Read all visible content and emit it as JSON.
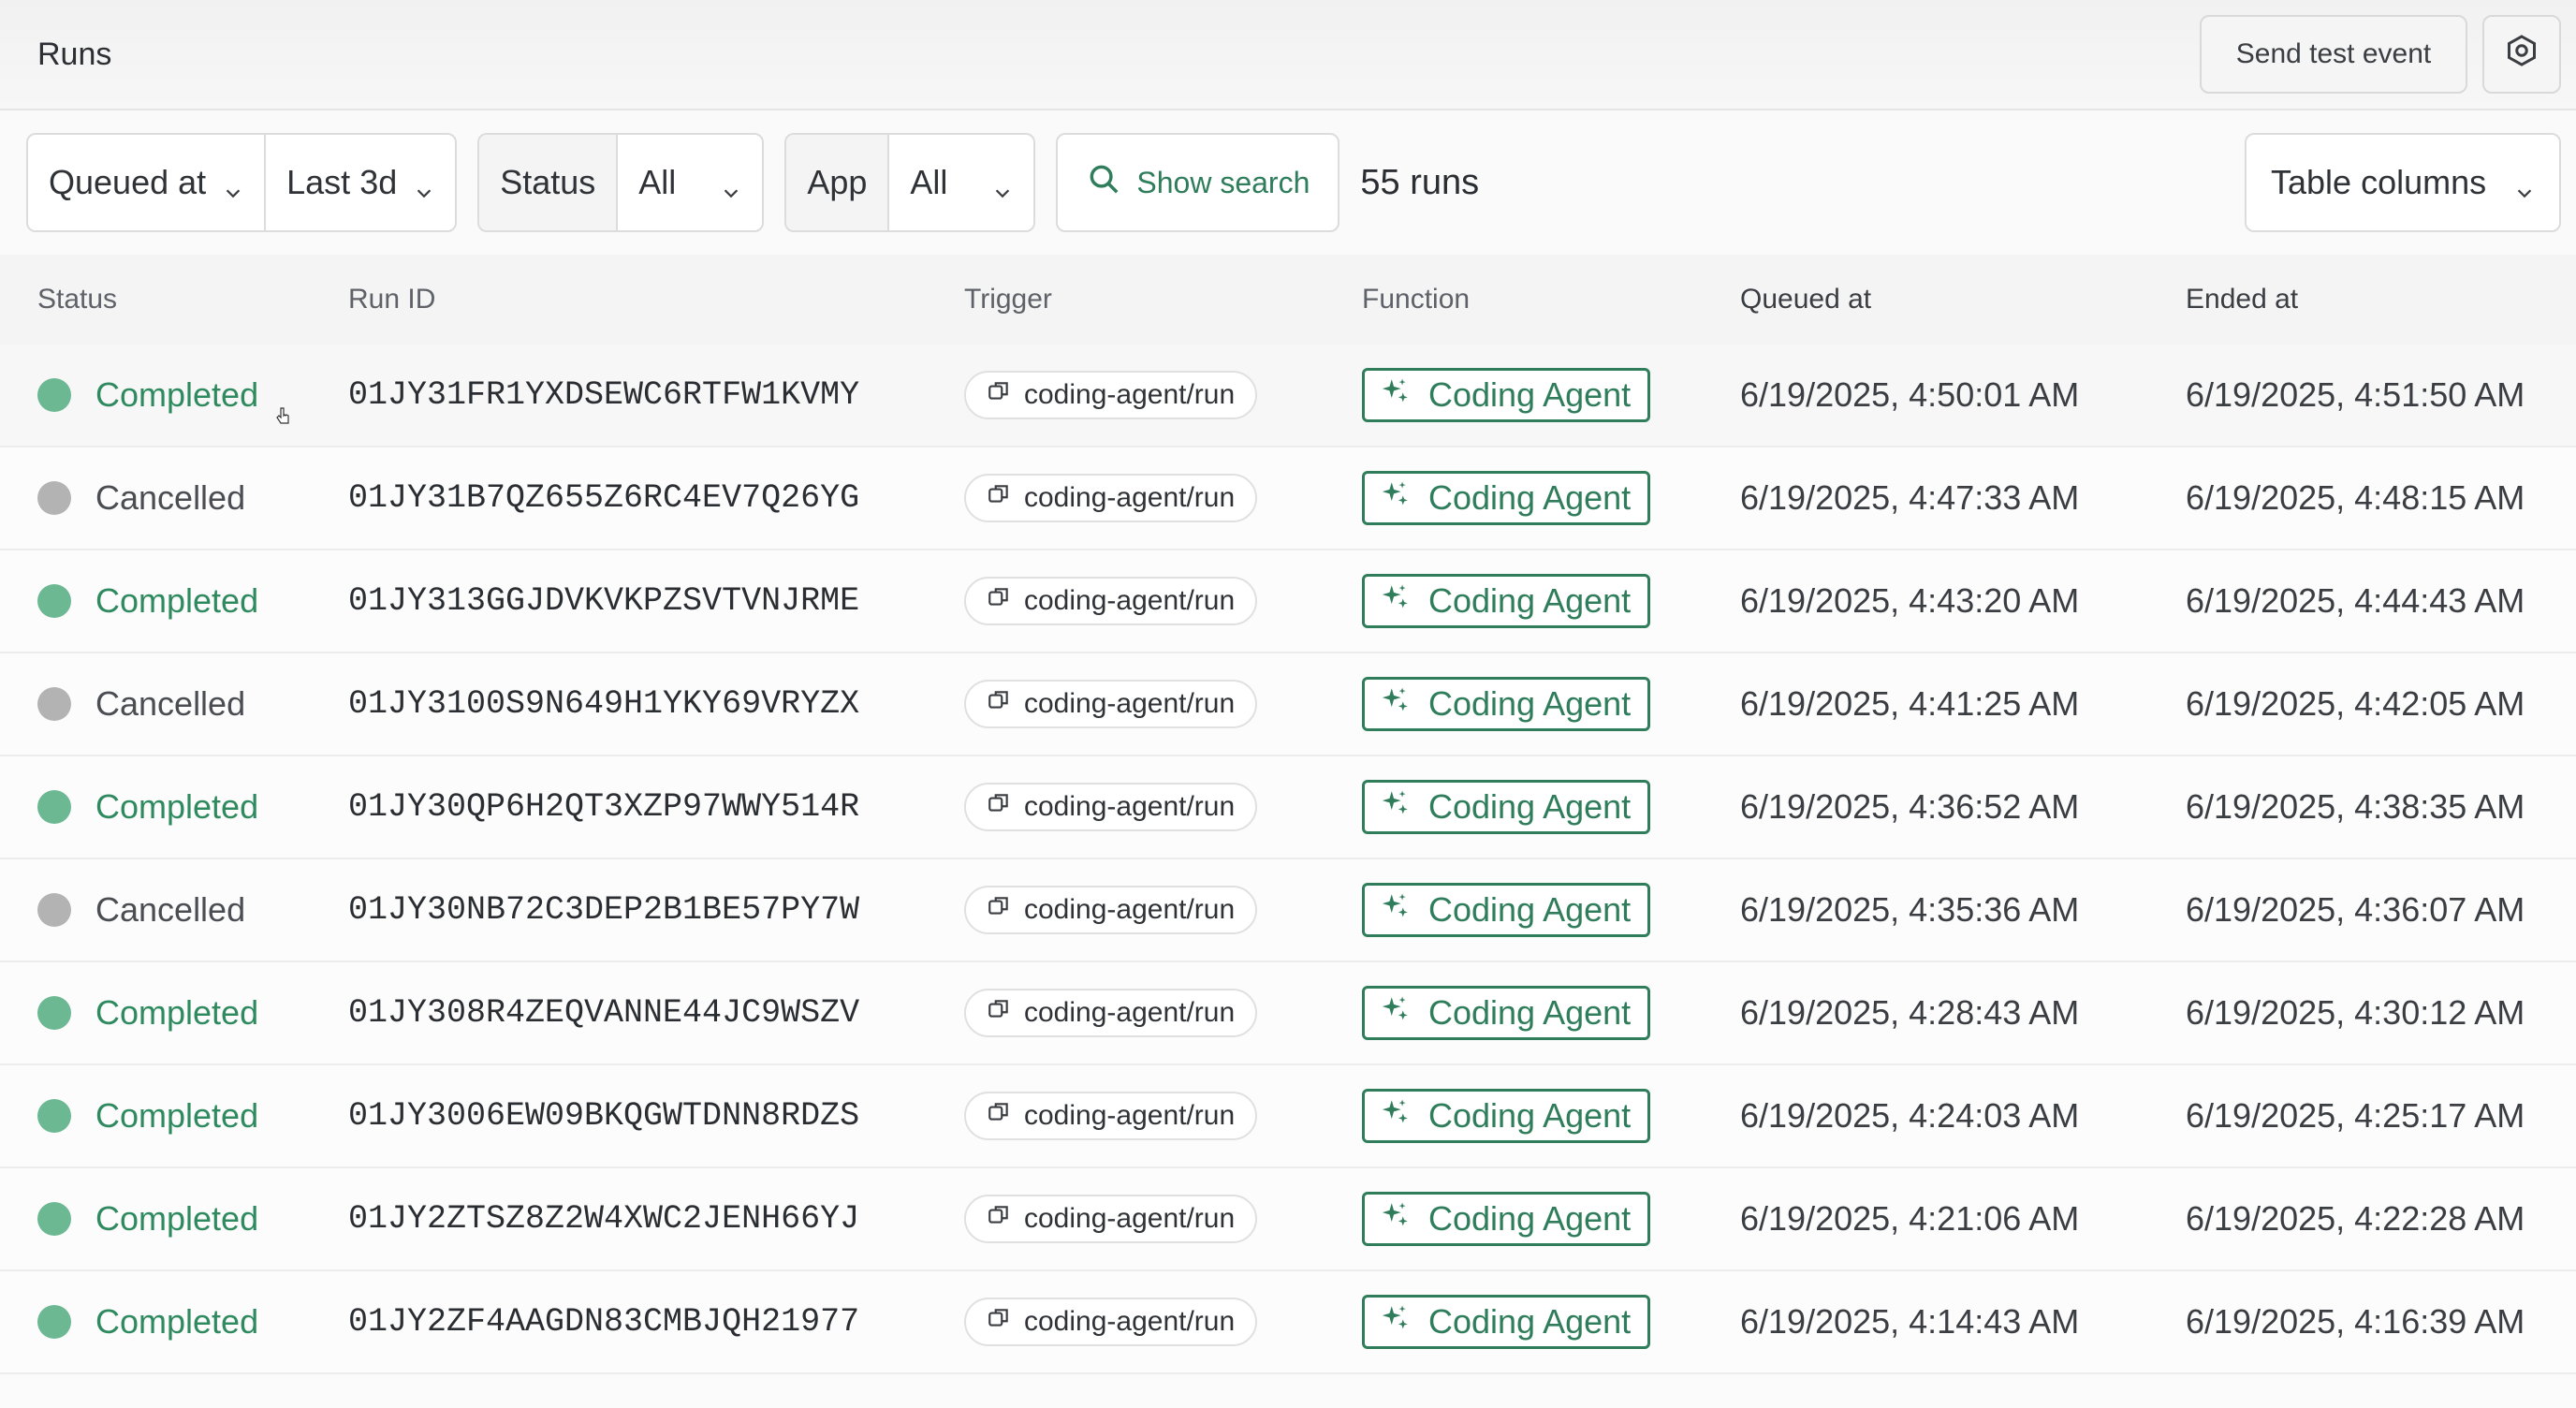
{
  "header": {
    "title": "Runs",
    "send_test_event": "Send test event",
    "settings_icon": "hexagon-gear-icon"
  },
  "filters": {
    "time_field": "Queued at",
    "time_range": "Last 3d",
    "status_label": "Status",
    "status_value": "All",
    "app_label": "App",
    "app_value": "All",
    "search_label": "Show search",
    "run_count": "55 runs",
    "table_columns": "Table columns"
  },
  "colors": {
    "completed": "#2f8a5f",
    "completed_dot": "#6bb893",
    "cancelled_dot": "#b3b3b3",
    "function_accent": "#2f7d5b"
  },
  "table": {
    "columns": [
      "Status",
      "Run ID",
      "Trigger",
      "Function",
      "Queued at",
      "Ended at"
    ],
    "rows": [
      {
        "status": "Completed",
        "run_id": "01JY31FR1YXDSEWC6RTFW1KVMY",
        "trigger": "coding-agent/run",
        "function": "Coding Agent",
        "queued_at": "6/19/2025, 4:50:01 AM",
        "ended_at": "6/19/2025, 4:51:50 AM"
      },
      {
        "status": "Cancelled",
        "run_id": "01JY31B7QZ655Z6RC4EV7Q26YG",
        "trigger": "coding-agent/run",
        "function": "Coding Agent",
        "queued_at": "6/19/2025, 4:47:33 AM",
        "ended_at": "6/19/2025, 4:48:15 AM"
      },
      {
        "status": "Completed",
        "run_id": "01JY313GGJDVKVKPZSVTVNJRME",
        "trigger": "coding-agent/run",
        "function": "Coding Agent",
        "queued_at": "6/19/2025, 4:43:20 AM",
        "ended_at": "6/19/2025, 4:44:43 AM"
      },
      {
        "status": "Cancelled",
        "run_id": "01JY3100S9N649H1YKY69VRYZX",
        "trigger": "coding-agent/run",
        "function": "Coding Agent",
        "queued_at": "6/19/2025, 4:41:25 AM",
        "ended_at": "6/19/2025, 4:42:05 AM"
      },
      {
        "status": "Completed",
        "run_id": "01JY30QP6H2QT3XZP97WWY514R",
        "trigger": "coding-agent/run",
        "function": "Coding Agent",
        "queued_at": "6/19/2025, 4:36:52 AM",
        "ended_at": "6/19/2025, 4:38:35 AM"
      },
      {
        "status": "Cancelled",
        "run_id": "01JY30NB72C3DEP2B1BE57PY7W",
        "trigger": "coding-agent/run",
        "function": "Coding Agent",
        "queued_at": "6/19/2025, 4:35:36 AM",
        "ended_at": "6/19/2025, 4:36:07 AM"
      },
      {
        "status": "Completed",
        "run_id": "01JY308R4ZEQVANNE44JC9WSZV",
        "trigger": "coding-agent/run",
        "function": "Coding Agent",
        "queued_at": "6/19/2025, 4:28:43 AM",
        "ended_at": "6/19/2025, 4:30:12 AM"
      },
      {
        "status": "Completed",
        "run_id": "01JY3006EW09BKQGWTDNN8RDZS",
        "trigger": "coding-agent/run",
        "function": "Coding Agent",
        "queued_at": "6/19/2025, 4:24:03 AM",
        "ended_at": "6/19/2025, 4:25:17 AM"
      },
      {
        "status": "Completed",
        "run_id": "01JY2ZTSZ8Z2W4XWC2JENH66YJ",
        "trigger": "coding-agent/run",
        "function": "Coding Agent",
        "queued_at": "6/19/2025, 4:21:06 AM",
        "ended_at": "6/19/2025, 4:22:28 AM"
      },
      {
        "status": "Completed",
        "run_id": "01JY2ZF4AAGDN83CMBJQH21977",
        "trigger": "coding-agent/run",
        "function": "Coding Agent",
        "queued_at": "6/19/2025, 4:14:43 AM",
        "ended_at": "6/19/2025, 4:16:39 AM"
      }
    ]
  }
}
